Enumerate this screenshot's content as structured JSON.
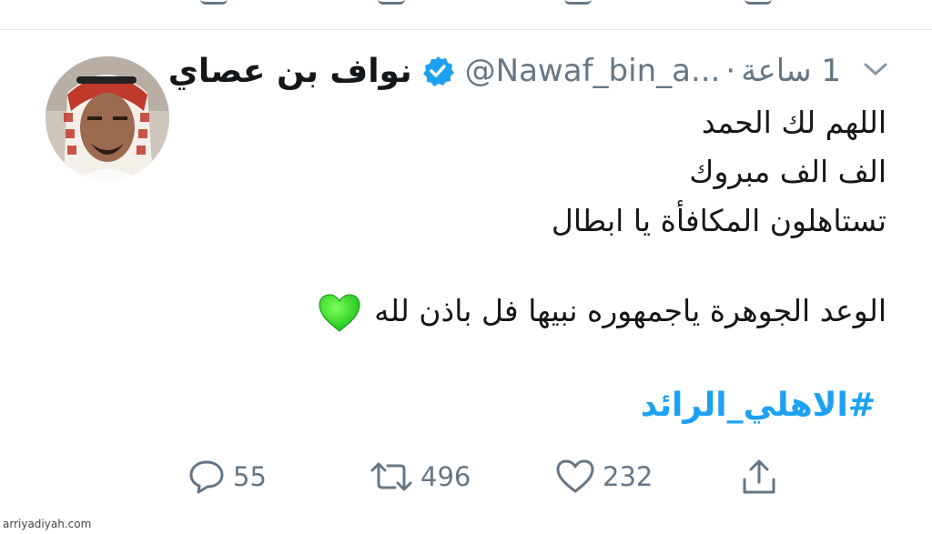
{
  "tweet": {
    "display_name": "نواف بن عصاي",
    "handle": "@Nawaf_bin_a...",
    "separator": "·",
    "time": "1 ساعة",
    "lines": [
      "اللهم لك الحمد",
      "الف الف مبروك",
      "تستاهلون المكافأة يا ابطال",
      "الوعد الجوهرة ياجمهوره نبيها  فل باذن لله"
    ],
    "hashtag": "#الاهلي_الرائد",
    "emoji": "green-heart",
    "accent_color": "#1da1f2",
    "verified_color": "#1da1f2"
  },
  "actions": {
    "replies": "55",
    "retweets": "496",
    "likes": "232"
  },
  "watermark": "arriyadiyah.com"
}
